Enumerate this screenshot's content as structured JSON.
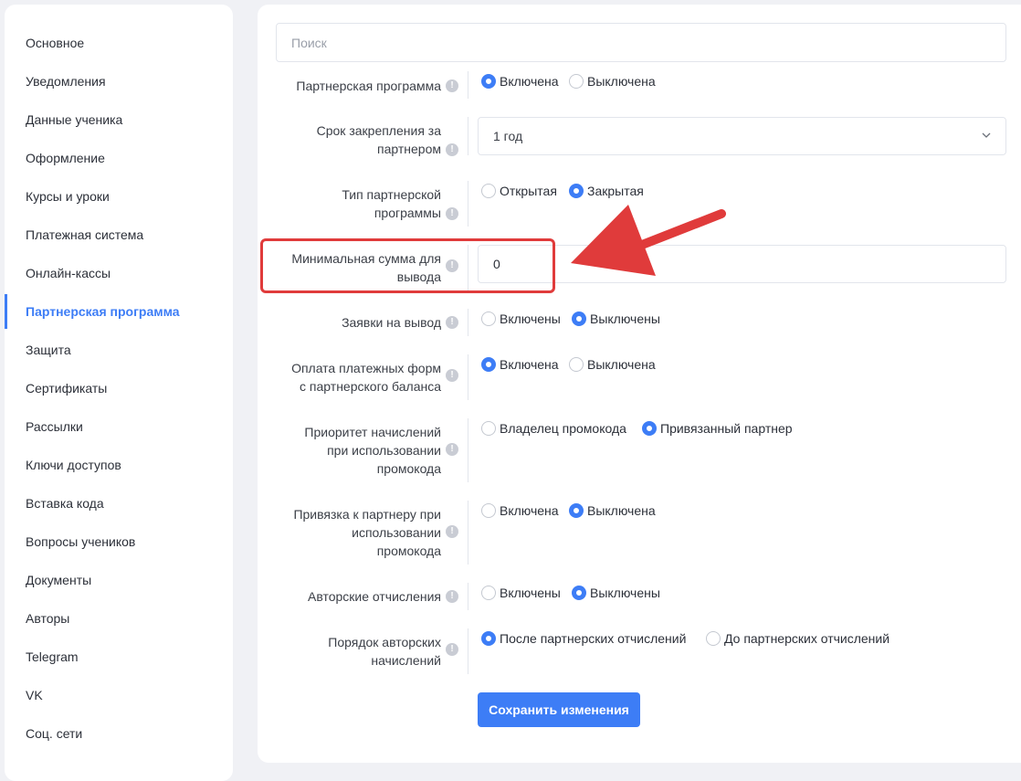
{
  "sidebar": {
    "items": [
      {
        "label": "Основное"
      },
      {
        "label": "Уведомления"
      },
      {
        "label": "Данные ученика"
      },
      {
        "label": "Оформление"
      },
      {
        "label": "Курсы и уроки"
      },
      {
        "label": "Платежная система"
      },
      {
        "label": "Онлайн-кассы"
      },
      {
        "label": "Партнерская программа",
        "active": true
      },
      {
        "label": "Защита"
      },
      {
        "label": "Сертификаты"
      },
      {
        "label": "Рассылки"
      },
      {
        "label": "Ключи доступов"
      },
      {
        "label": "Вставка кода"
      },
      {
        "label": "Вопросы учеников"
      },
      {
        "label": "Документы"
      },
      {
        "label": "Авторы"
      },
      {
        "label": "Telegram"
      },
      {
        "label": "VK"
      },
      {
        "label": "Соц. сети"
      }
    ]
  },
  "search": {
    "placeholder": "Поиск",
    "value": ""
  },
  "settings": {
    "partner_program": {
      "label": "Партнерская программа",
      "options": [
        "Включена",
        "Выключена"
      ],
      "selected": 0
    },
    "binding_period": {
      "label_line1": "Срок закрепления за",
      "label_line2": "партнером",
      "value": "1 год"
    },
    "program_type": {
      "label_line1": "Тип партнерской",
      "label_line2": "программы",
      "options": [
        "Открытая",
        "Закрытая"
      ],
      "selected": 1
    },
    "min_withdrawal": {
      "label_line1": "Минимальная сумма для",
      "label_line2": "вывода",
      "value": "0"
    },
    "withdrawal_requests": {
      "label": "Заявки на вывод",
      "options": [
        "Включены",
        "Выключены"
      ],
      "selected": 1
    },
    "payment_from_balance": {
      "label_line1": "Оплата платежных форм",
      "label_line2": "с партнерского баланса",
      "options": [
        "Включена",
        "Выключена"
      ],
      "selected": 0
    },
    "promo_priority": {
      "label_line1": "Приоритет начислений",
      "label_line2": "при использовании",
      "label_line3": "промокода",
      "options": [
        "Владелец промокода",
        "Привязанный партнер"
      ],
      "selected": 1
    },
    "promo_binding": {
      "label_line1": "Привязка к партнеру при",
      "label_line2": "использовании",
      "label_line3": "промокода",
      "options": [
        "Включена",
        "Выключена"
      ],
      "selected": 1
    },
    "author_fees": {
      "label": "Авторские отчисления",
      "options": [
        "Включены",
        "Выключены"
      ],
      "selected": 1
    },
    "author_fees_order": {
      "label_line1": "Порядок авторских",
      "label_line2": "начислений",
      "options": [
        "После партнерских отчислений",
        "До партнерских отчислений"
      ],
      "selected": 0
    }
  },
  "info_icon_glyph": "!",
  "save_button": {
    "label": "Сохранить изменения"
  },
  "colors": {
    "accent": "#3d7df6",
    "highlight": "#e03b3b",
    "background": "#f0f1f5"
  }
}
